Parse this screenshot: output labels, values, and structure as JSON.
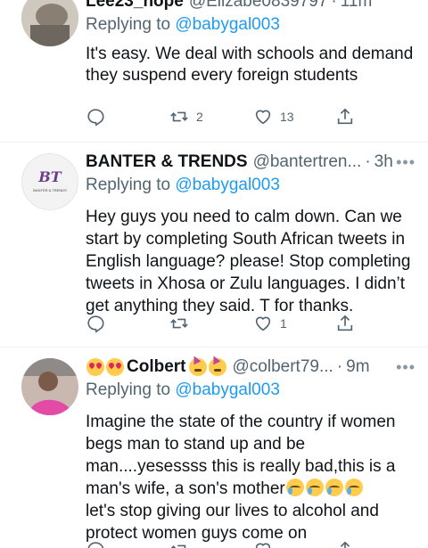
{
  "tweets": [
    {
      "display_name": "Lee23_hope",
      "handle": "@Elizabe0839797",
      "time": "11m",
      "reply_prefix": "Replying to",
      "reply_to": "@babygal003",
      "body": "It's easy. We deal with schools and demand they suspend every foreign students",
      "retweets": "2",
      "likes": "13"
    },
    {
      "display_name": "BANTER & TRENDS",
      "handle": "@bantertren...",
      "time": "3h",
      "avatar_text": "BT",
      "avatar_subtext": "BANTER & TRENDS",
      "reply_prefix": "Replying to",
      "reply_to": "@babygal003",
      "body": "Hey guys you need to calm down. Can we start by completing South African tweets in English language? please! Stop completing tweets in Xhosa or Zulu languages. I didn’t get anything they said. T for thanks.",
      "retweets": "",
      "likes": "1"
    },
    {
      "display_name": "Colbert",
      "handle": "@colbert79...",
      "time": "9m",
      "reply_prefix": "Replying to",
      "reply_to": "@babygal003",
      "body_part1": "Imagine the state of the country if women begs man to stand up and be man....yesessss  this is really bad,this is a man's wife, a son's mother",
      "body_part2": "let's stop giving our lives to alcohol and protect women guys come on"
    }
  ],
  "dot": "·",
  "more": "•••",
  "colors": {
    "accent": "#1d9bf0",
    "secondary_text": "#536471",
    "divider": "#eff3f4"
  }
}
